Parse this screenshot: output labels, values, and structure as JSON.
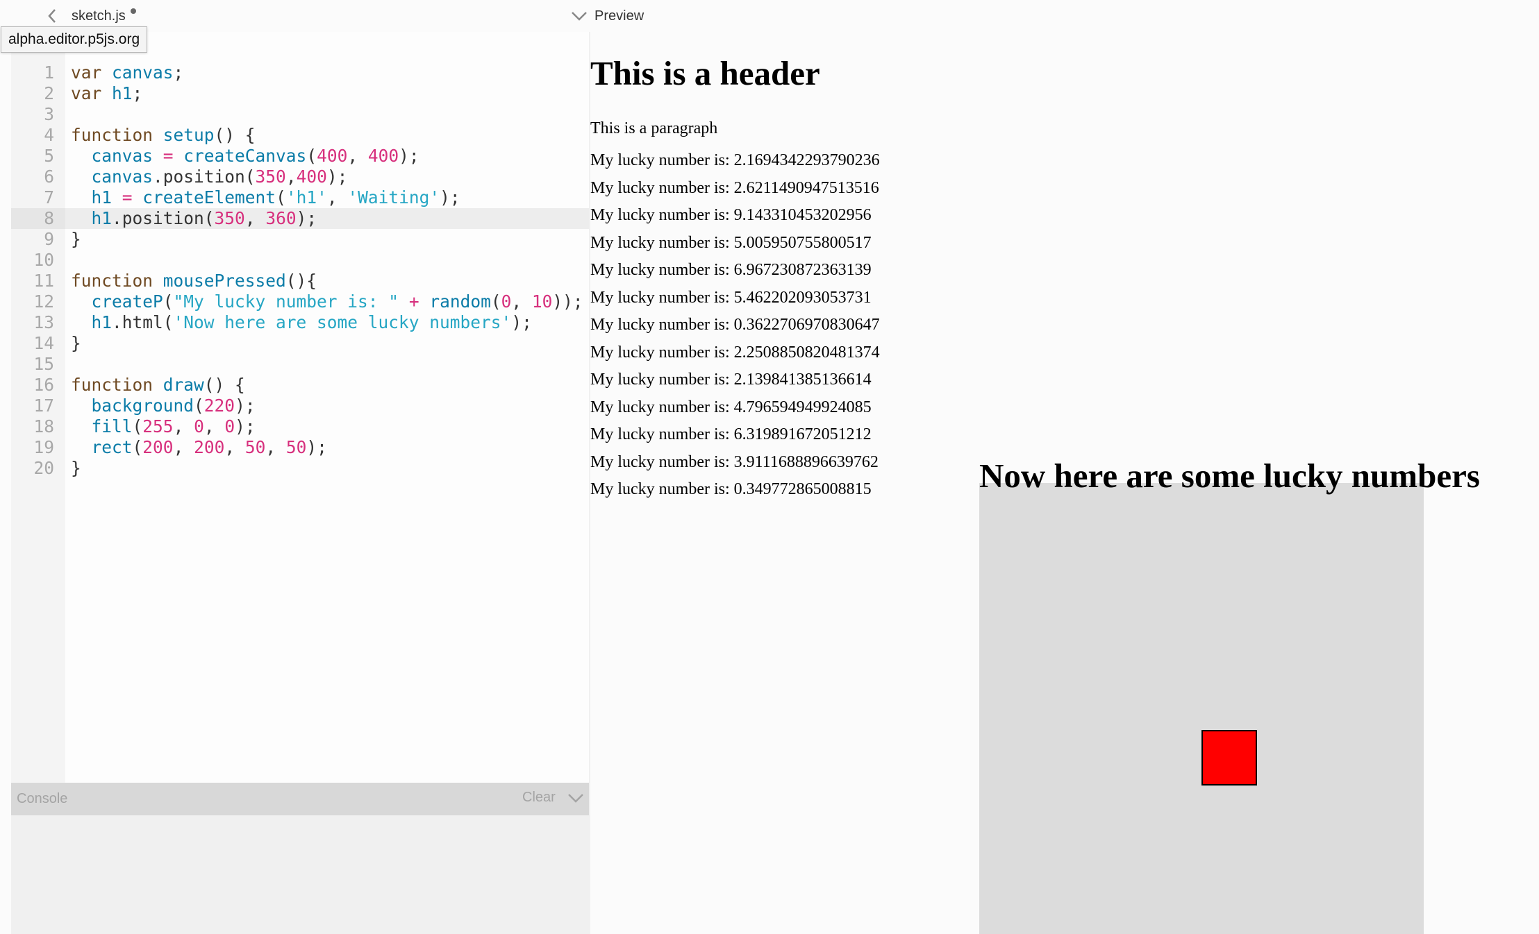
{
  "editor": {
    "file_name": "sketch.js",
    "tooltip_url": "alpha.editor.p5js.org",
    "active_line": 8,
    "lines": [
      {
        "n": "1",
        "tokens": [
          {
            "c": "kw",
            "t": "var "
          },
          {
            "c": "fn",
            "t": "canvas"
          },
          {
            "c": "plain",
            "t": ";"
          }
        ]
      },
      {
        "n": "2",
        "tokens": [
          {
            "c": "kw",
            "t": "var "
          },
          {
            "c": "fn",
            "t": "h1"
          },
          {
            "c": "plain",
            "t": ";"
          }
        ]
      },
      {
        "n": "3",
        "tokens": []
      },
      {
        "n": "4",
        "tokens": [
          {
            "c": "kw",
            "t": "function "
          },
          {
            "c": "fn",
            "t": "setup"
          },
          {
            "c": "plain",
            "t": "() {"
          }
        ]
      },
      {
        "n": "5",
        "tokens": [
          {
            "c": "plain",
            "t": "  "
          },
          {
            "c": "fn",
            "t": "canvas"
          },
          {
            "c": "op",
            "t": " = "
          },
          {
            "c": "fn",
            "t": "createCanvas"
          },
          {
            "c": "plain",
            "t": "("
          },
          {
            "c": "num",
            "t": "400"
          },
          {
            "c": "plain",
            "t": ", "
          },
          {
            "c": "num",
            "t": "400"
          },
          {
            "c": "plain",
            "t": ");"
          }
        ]
      },
      {
        "n": "6",
        "tokens": [
          {
            "c": "plain",
            "t": "  "
          },
          {
            "c": "fn",
            "t": "canvas"
          },
          {
            "c": "plain",
            "t": ".position("
          },
          {
            "c": "num",
            "t": "350"
          },
          {
            "c": "plain",
            "t": ","
          },
          {
            "c": "num",
            "t": "400"
          },
          {
            "c": "plain",
            "t": ");"
          }
        ]
      },
      {
        "n": "7",
        "tokens": [
          {
            "c": "plain",
            "t": "  "
          },
          {
            "c": "fn",
            "t": "h1"
          },
          {
            "c": "op",
            "t": " = "
          },
          {
            "c": "fn",
            "t": "createElement"
          },
          {
            "c": "plain",
            "t": "("
          },
          {
            "c": "str",
            "t": "'h1'"
          },
          {
            "c": "plain",
            "t": ", "
          },
          {
            "c": "str",
            "t": "'Waiting'"
          },
          {
            "c": "plain",
            "t": ");"
          }
        ]
      },
      {
        "n": "8",
        "tokens": [
          {
            "c": "plain",
            "t": "  "
          },
          {
            "c": "fn",
            "t": "h1"
          },
          {
            "c": "plain",
            "t": ".position("
          },
          {
            "c": "num",
            "t": "350"
          },
          {
            "c": "plain",
            "t": ", "
          },
          {
            "c": "num",
            "t": "360"
          },
          {
            "c": "plain",
            "t": ");"
          }
        ]
      },
      {
        "n": "9",
        "tokens": [
          {
            "c": "plain",
            "t": "}"
          }
        ]
      },
      {
        "n": "10",
        "tokens": []
      },
      {
        "n": "11",
        "tokens": [
          {
            "c": "kw",
            "t": "function "
          },
          {
            "c": "fn",
            "t": "mousePressed"
          },
          {
            "c": "plain",
            "t": "(){"
          }
        ]
      },
      {
        "n": "12",
        "tokens": [
          {
            "c": "plain",
            "t": "  "
          },
          {
            "c": "fn",
            "t": "createP"
          },
          {
            "c": "plain",
            "t": "("
          },
          {
            "c": "str",
            "t": "\"My lucky number is: \""
          },
          {
            "c": "op",
            "t": " + "
          },
          {
            "c": "fn",
            "t": "random"
          },
          {
            "c": "plain",
            "t": "("
          },
          {
            "c": "num",
            "t": "0"
          },
          {
            "c": "plain",
            "t": ", "
          },
          {
            "c": "num",
            "t": "10"
          },
          {
            "c": "plain",
            "t": "));"
          }
        ]
      },
      {
        "n": "13",
        "tokens": [
          {
            "c": "plain",
            "t": "  "
          },
          {
            "c": "fn",
            "t": "h1"
          },
          {
            "c": "plain",
            "t": ".html("
          },
          {
            "c": "str",
            "t": "'Now here are some lucky numbers'"
          },
          {
            "c": "plain",
            "t": ");"
          }
        ]
      },
      {
        "n": "14",
        "tokens": [
          {
            "c": "plain",
            "t": "}"
          }
        ]
      },
      {
        "n": "15",
        "tokens": []
      },
      {
        "n": "16",
        "tokens": [
          {
            "c": "kw",
            "t": "function "
          },
          {
            "c": "fn",
            "t": "draw"
          },
          {
            "c": "plain",
            "t": "() {"
          }
        ]
      },
      {
        "n": "17",
        "tokens": [
          {
            "c": "plain",
            "t": "  "
          },
          {
            "c": "fn",
            "t": "background"
          },
          {
            "c": "plain",
            "t": "("
          },
          {
            "c": "num",
            "t": "220"
          },
          {
            "c": "plain",
            "t": ");"
          }
        ]
      },
      {
        "n": "18",
        "tokens": [
          {
            "c": "plain",
            "t": "  "
          },
          {
            "c": "fn",
            "t": "fill"
          },
          {
            "c": "plain",
            "t": "("
          },
          {
            "c": "num",
            "t": "255"
          },
          {
            "c": "plain",
            "t": ", "
          },
          {
            "c": "num",
            "t": "0"
          },
          {
            "c": "plain",
            "t": ", "
          },
          {
            "c": "num",
            "t": "0"
          },
          {
            "c": "plain",
            "t": ");"
          }
        ]
      },
      {
        "n": "19",
        "tokens": [
          {
            "c": "plain",
            "t": "  "
          },
          {
            "c": "fn",
            "t": "rect"
          },
          {
            "c": "plain",
            "t": "("
          },
          {
            "c": "num",
            "t": "200"
          },
          {
            "c": "plain",
            "t": ", "
          },
          {
            "c": "num",
            "t": "200"
          },
          {
            "c": "plain",
            "t": ", "
          },
          {
            "c": "num",
            "t": "50"
          },
          {
            "c": "plain",
            "t": ", "
          },
          {
            "c": "num",
            "t": "50"
          },
          {
            "c": "plain",
            "t": ");"
          }
        ]
      },
      {
        "n": "20",
        "tokens": [
          {
            "c": "plain",
            "t": "}"
          }
        ]
      }
    ]
  },
  "console": {
    "title": "Console",
    "clear_label": "Clear"
  },
  "preview": {
    "label": "Preview",
    "header": "This is a header",
    "paragraph": "This is a paragraph",
    "lucky_numbers": [
      "My lucky number is: 2.1694342293790236",
      "My lucky number is: 2.6211490947513516",
      "My lucky number is: 9.143310453202956",
      "My lucky number is: 5.005950755800517",
      "My lucky number is: 6.967230872363139",
      "My lucky number is: 5.462202093053731",
      "My lucky number is: 0.3622706970830647",
      "My lucky number is: 2.2508850820481374",
      "My lucky number is: 2.139841385136614",
      "My lucky number is: 4.796594949924085",
      "My lucky number is: 6.319891672051212",
      "My lucky number is: 3.9111688896639762",
      "My lucky number is: 0.349772865008815"
    ],
    "sketch_heading": "Now here are some lucky numbers"
  },
  "colors": {
    "canvas_background": "#dcdcdc",
    "rect_fill": "#ff0000",
    "keyword": "#6f4a23",
    "identifier": "#0b7ca8",
    "string": "#26a6c4",
    "number": "#d7307d"
  }
}
